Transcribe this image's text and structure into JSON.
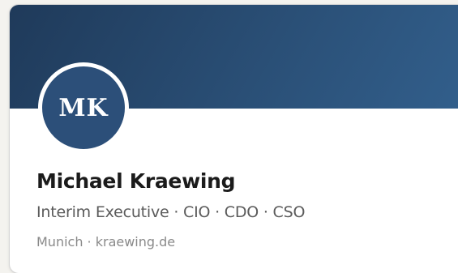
{
  "profile": {
    "initials": "MK",
    "name": "Michael Kraewing",
    "roles": "Interim Executive · CIO · CDO · CSO",
    "meta": "Munich · kraewing.de"
  },
  "colors": {
    "banner_start": "#1f3a5a",
    "banner_end": "#325f8c",
    "avatar_bg": "#2c4f79",
    "name_text": "#1b1b1b",
    "roles_text": "#5b5b5b",
    "meta_text": "#8a8a8a"
  }
}
